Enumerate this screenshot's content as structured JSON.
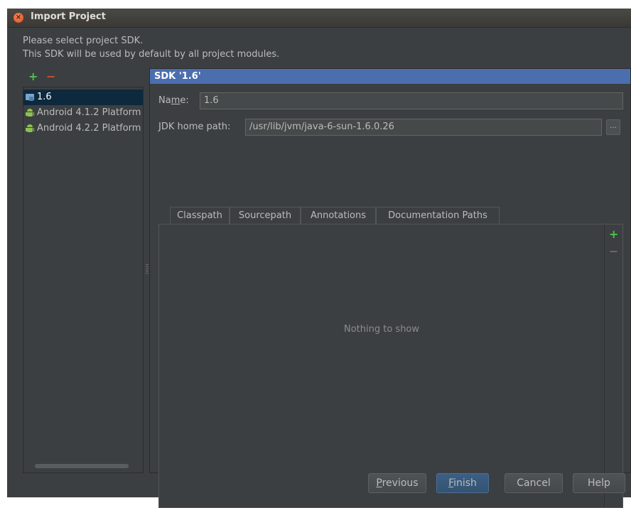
{
  "window": {
    "title": "Import Project"
  },
  "intro": {
    "line1": "Please select project SDK.",
    "line2": "This SDK will be used by default by all project modules."
  },
  "toolbar": {
    "add": "+",
    "remove": "−"
  },
  "sdk_list": [
    {
      "label": "1.6",
      "icon": "jdk-folder-icon",
      "selected": true
    },
    {
      "label": "Android 4.1.2 Platform",
      "icon": "android-icon",
      "selected": false
    },
    {
      "label": "Android 4.2.2 Platform",
      "icon": "android-icon",
      "selected": false
    }
  ],
  "details": {
    "header": "SDK '1.6'",
    "name_label_pre": "Na",
    "name_label_u": "m",
    "name_label_post": "e:",
    "name_value": "1.6",
    "home_label": "JDK home path:",
    "home_value": "/usr/lib/jvm/java-6-sun-1.6.0.26",
    "browse": "...",
    "tabs": [
      "Classpath",
      "Sourcepath",
      "Annotations",
      "Documentation Paths"
    ],
    "empty_text": "Nothing to show",
    "side_add": "+",
    "side_remove": "−"
  },
  "buttons": {
    "previous_u": "P",
    "previous_rest": "revious",
    "finish_u": "F",
    "finish_rest": "inish",
    "cancel": "Cancel",
    "help": "Help"
  },
  "colors": {
    "background": "#3c3f41",
    "selection": "#0d293e",
    "header": "#4b6eaf",
    "add": "#4fc24f",
    "remove": "#c7503a"
  }
}
